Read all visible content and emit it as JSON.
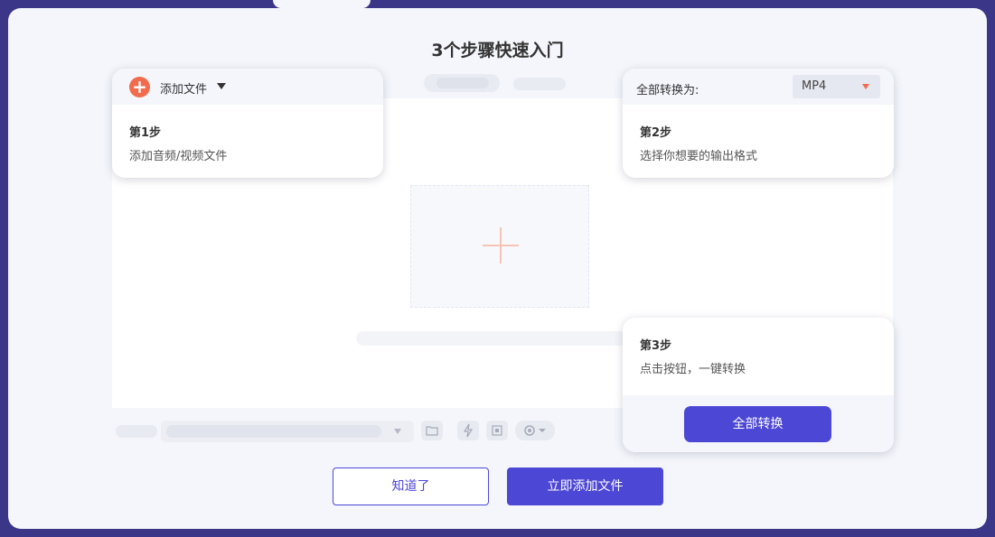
{
  "title": "3个步骤快速入门",
  "step1": {
    "add_button": "添加文件",
    "step_title": "第1步",
    "description": "添加音频/视频文件"
  },
  "step2": {
    "convert_label": "全部转换为:",
    "format_value": "MP4",
    "step_title": "第2步",
    "description": "选择你想要的输出格式"
  },
  "step3": {
    "step_title": "第3步",
    "description": "点击按钮，一键转换",
    "convert_all_button": "全部转换"
  },
  "footer": {
    "got_it_button": "知道了",
    "add_now_button": "立即添加文件"
  },
  "colors": {
    "accent": "#4d47d6",
    "orange": "#f26b4c",
    "frame": "#3b3687"
  },
  "icons": {
    "add": "plus-circle-icon",
    "drop": "plus-icon",
    "folder": "folder-icon",
    "flash": "lightning-off-icon",
    "cpu": "cpu-off-icon",
    "settings": "gear-icon"
  }
}
